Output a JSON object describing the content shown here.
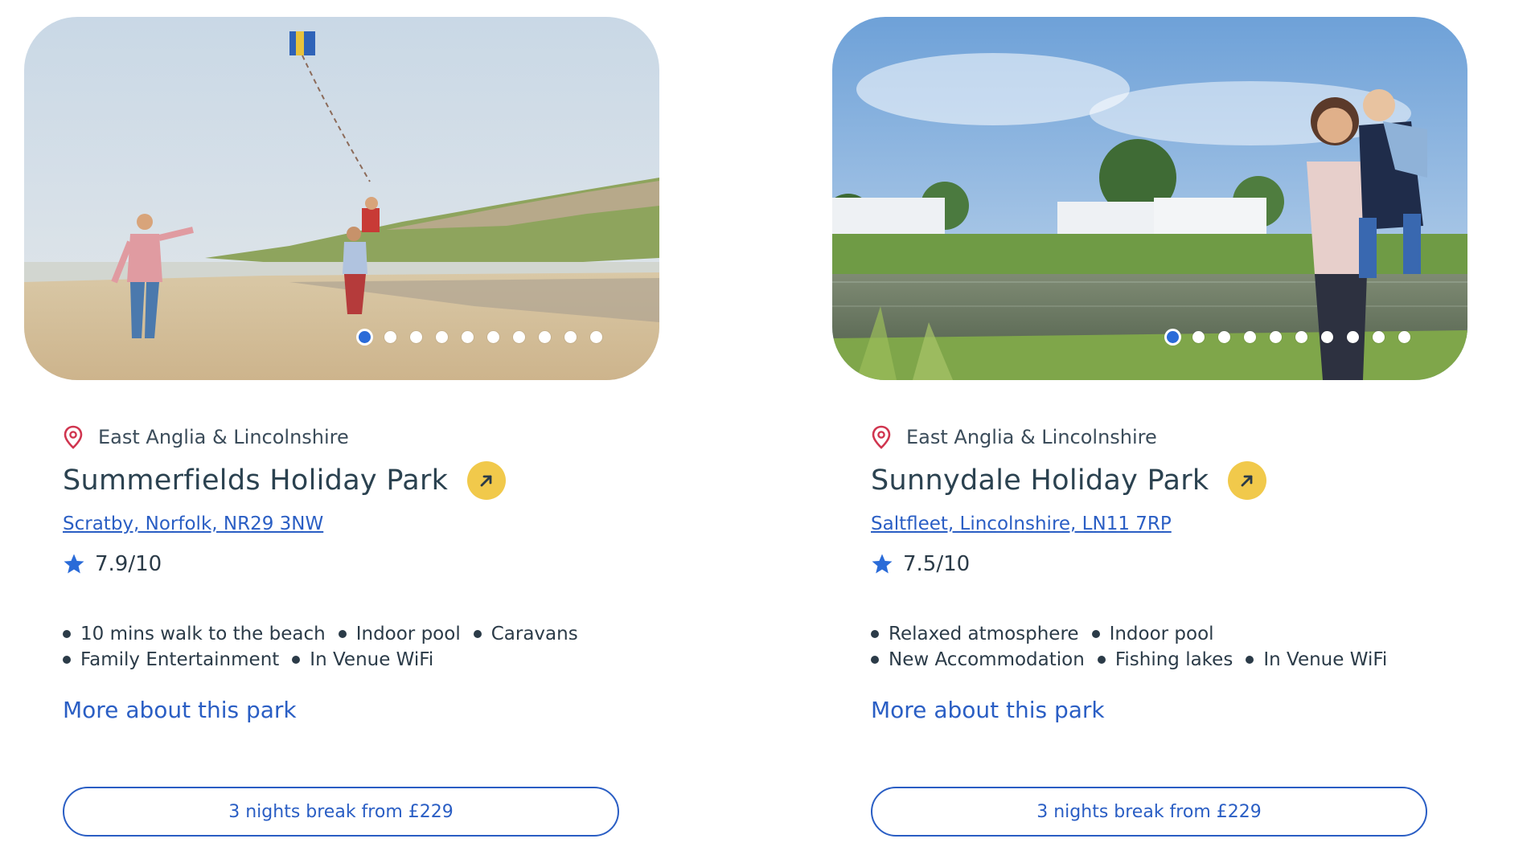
{
  "colors": {
    "link": "#2a5ec4",
    "heading": "#2b4250",
    "text": "#2b3b48",
    "pin": "#d0354f",
    "star": "#2a6bd8",
    "arrow_button": "#f1c94b",
    "active_dot": "#2a6bd8"
  },
  "parks": [
    {
      "region": "East Anglia & Lincolnshire",
      "region_icon": "location-pin-icon",
      "name": "Summerfields Holiday Park",
      "address": "Scratby, Norfolk, NR29 3NW",
      "rating": "7.9/10",
      "rating_icon": "star-icon",
      "features": [
        "10 mins walk to the beach",
        "Indoor pool",
        "Caravans",
        "Family Entertainment",
        "In Venue WiFi"
      ],
      "more_link": "More about this park",
      "cta": "3 nights break from £229",
      "carousel": {
        "slides": 10,
        "active": 1
      }
    },
    {
      "region": "East Anglia & Lincolnshire",
      "region_icon": "location-pin-icon",
      "name": "Sunnydale Holiday Park",
      "address": "Saltfleet, Lincolnshire, LN11 7RP",
      "rating": "7.5/10",
      "rating_icon": "star-icon",
      "features": [
        "Relaxed atmosphere",
        "Indoor pool",
        "New Accommodation",
        "Fishing lakes",
        "In Venue WiFi"
      ],
      "more_link": "More about this park",
      "cta": "3 nights break from £229",
      "carousel": {
        "slides": 10,
        "active": 1
      }
    }
  ]
}
